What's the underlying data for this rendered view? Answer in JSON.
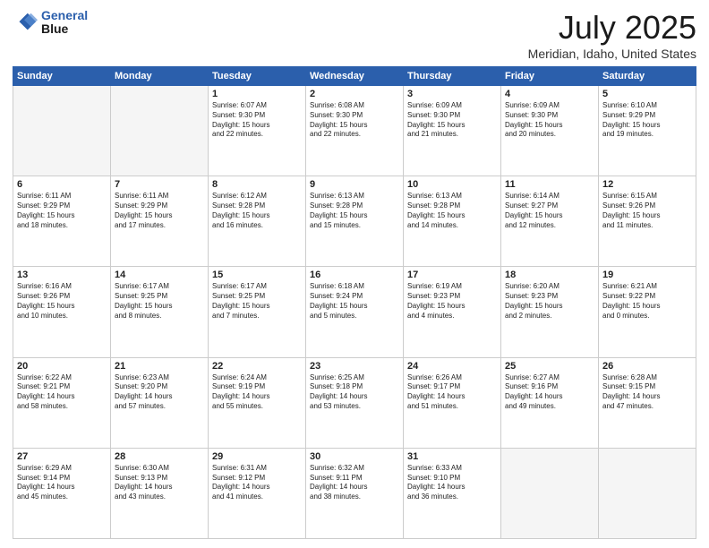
{
  "header": {
    "logo_line1": "General",
    "logo_line2": "Blue",
    "title": "July 2025",
    "subtitle": "Meridian, Idaho, United States"
  },
  "weekdays": [
    "Sunday",
    "Monday",
    "Tuesday",
    "Wednesday",
    "Thursday",
    "Friday",
    "Saturday"
  ],
  "weeks": [
    [
      {
        "day": "",
        "info": ""
      },
      {
        "day": "",
        "info": ""
      },
      {
        "day": "1",
        "info": "Sunrise: 6:07 AM\nSunset: 9:30 PM\nDaylight: 15 hours\nand 22 minutes."
      },
      {
        "day": "2",
        "info": "Sunrise: 6:08 AM\nSunset: 9:30 PM\nDaylight: 15 hours\nand 22 minutes."
      },
      {
        "day": "3",
        "info": "Sunrise: 6:09 AM\nSunset: 9:30 PM\nDaylight: 15 hours\nand 21 minutes."
      },
      {
        "day": "4",
        "info": "Sunrise: 6:09 AM\nSunset: 9:30 PM\nDaylight: 15 hours\nand 20 minutes."
      },
      {
        "day": "5",
        "info": "Sunrise: 6:10 AM\nSunset: 9:29 PM\nDaylight: 15 hours\nand 19 minutes."
      }
    ],
    [
      {
        "day": "6",
        "info": "Sunrise: 6:11 AM\nSunset: 9:29 PM\nDaylight: 15 hours\nand 18 minutes."
      },
      {
        "day": "7",
        "info": "Sunrise: 6:11 AM\nSunset: 9:29 PM\nDaylight: 15 hours\nand 17 minutes."
      },
      {
        "day": "8",
        "info": "Sunrise: 6:12 AM\nSunset: 9:28 PM\nDaylight: 15 hours\nand 16 minutes."
      },
      {
        "day": "9",
        "info": "Sunrise: 6:13 AM\nSunset: 9:28 PM\nDaylight: 15 hours\nand 15 minutes."
      },
      {
        "day": "10",
        "info": "Sunrise: 6:13 AM\nSunset: 9:28 PM\nDaylight: 15 hours\nand 14 minutes."
      },
      {
        "day": "11",
        "info": "Sunrise: 6:14 AM\nSunset: 9:27 PM\nDaylight: 15 hours\nand 12 minutes."
      },
      {
        "day": "12",
        "info": "Sunrise: 6:15 AM\nSunset: 9:26 PM\nDaylight: 15 hours\nand 11 minutes."
      }
    ],
    [
      {
        "day": "13",
        "info": "Sunrise: 6:16 AM\nSunset: 9:26 PM\nDaylight: 15 hours\nand 10 minutes."
      },
      {
        "day": "14",
        "info": "Sunrise: 6:17 AM\nSunset: 9:25 PM\nDaylight: 15 hours\nand 8 minutes."
      },
      {
        "day": "15",
        "info": "Sunrise: 6:17 AM\nSunset: 9:25 PM\nDaylight: 15 hours\nand 7 minutes."
      },
      {
        "day": "16",
        "info": "Sunrise: 6:18 AM\nSunset: 9:24 PM\nDaylight: 15 hours\nand 5 minutes."
      },
      {
        "day": "17",
        "info": "Sunrise: 6:19 AM\nSunset: 9:23 PM\nDaylight: 15 hours\nand 4 minutes."
      },
      {
        "day": "18",
        "info": "Sunrise: 6:20 AM\nSunset: 9:23 PM\nDaylight: 15 hours\nand 2 minutes."
      },
      {
        "day": "19",
        "info": "Sunrise: 6:21 AM\nSunset: 9:22 PM\nDaylight: 15 hours\nand 0 minutes."
      }
    ],
    [
      {
        "day": "20",
        "info": "Sunrise: 6:22 AM\nSunset: 9:21 PM\nDaylight: 14 hours\nand 58 minutes."
      },
      {
        "day": "21",
        "info": "Sunrise: 6:23 AM\nSunset: 9:20 PM\nDaylight: 14 hours\nand 57 minutes."
      },
      {
        "day": "22",
        "info": "Sunrise: 6:24 AM\nSunset: 9:19 PM\nDaylight: 14 hours\nand 55 minutes."
      },
      {
        "day": "23",
        "info": "Sunrise: 6:25 AM\nSunset: 9:18 PM\nDaylight: 14 hours\nand 53 minutes."
      },
      {
        "day": "24",
        "info": "Sunrise: 6:26 AM\nSunset: 9:17 PM\nDaylight: 14 hours\nand 51 minutes."
      },
      {
        "day": "25",
        "info": "Sunrise: 6:27 AM\nSunset: 9:16 PM\nDaylight: 14 hours\nand 49 minutes."
      },
      {
        "day": "26",
        "info": "Sunrise: 6:28 AM\nSunset: 9:15 PM\nDaylight: 14 hours\nand 47 minutes."
      }
    ],
    [
      {
        "day": "27",
        "info": "Sunrise: 6:29 AM\nSunset: 9:14 PM\nDaylight: 14 hours\nand 45 minutes."
      },
      {
        "day": "28",
        "info": "Sunrise: 6:30 AM\nSunset: 9:13 PM\nDaylight: 14 hours\nand 43 minutes."
      },
      {
        "day": "29",
        "info": "Sunrise: 6:31 AM\nSunset: 9:12 PM\nDaylight: 14 hours\nand 41 minutes."
      },
      {
        "day": "30",
        "info": "Sunrise: 6:32 AM\nSunset: 9:11 PM\nDaylight: 14 hours\nand 38 minutes."
      },
      {
        "day": "31",
        "info": "Sunrise: 6:33 AM\nSunset: 9:10 PM\nDaylight: 14 hours\nand 36 minutes."
      },
      {
        "day": "",
        "info": ""
      },
      {
        "day": "",
        "info": ""
      }
    ]
  ]
}
